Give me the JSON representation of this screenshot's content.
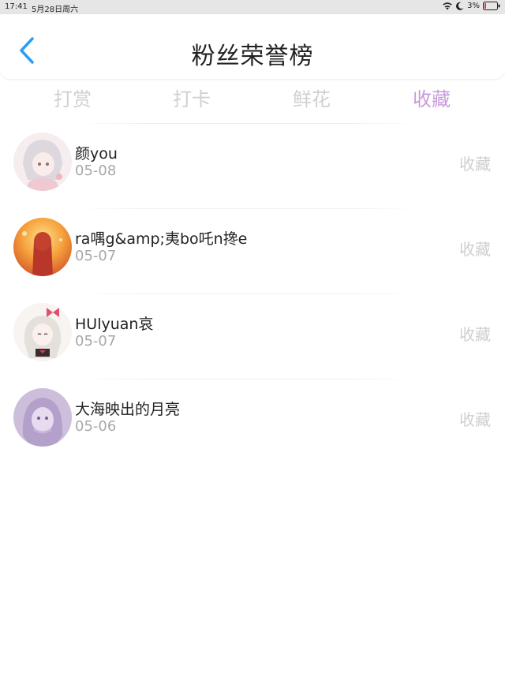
{
  "status_bar": {
    "time": "17:41",
    "date": "5月28日周六",
    "battery": "3%"
  },
  "header": {
    "title": "粉丝荣誉榜"
  },
  "tabs": [
    {
      "label": "打赏"
    },
    {
      "label": "打卡"
    },
    {
      "label": "鲜花"
    },
    {
      "label": "收藏"
    }
  ],
  "active_tab": 3,
  "colors": {
    "accent": "#2a9df4",
    "active_tab": "#c99bdc",
    "inactive_tab": "#d0d0d0"
  },
  "users": [
    {
      "name": "颜you",
      "date": "05-08",
      "action": "收藏",
      "avatar_icon": "anime-girl-white-hair-avatar"
    },
    {
      "name": "ra喁g&amp;夷bo吒n搀e",
      "date": "05-07",
      "action": "收藏",
      "avatar_icon": "anime-girl-red-sunset-avatar"
    },
    {
      "name": "HUlyuan哀",
      "date": "05-07",
      "action": "收藏",
      "avatar_icon": "anime-girl-ribbon-avatar"
    },
    {
      "name": "大海映出的月亮",
      "date": "05-06",
      "action": "收藏",
      "avatar_icon": "anime-girl-purple-avatar"
    }
  ]
}
